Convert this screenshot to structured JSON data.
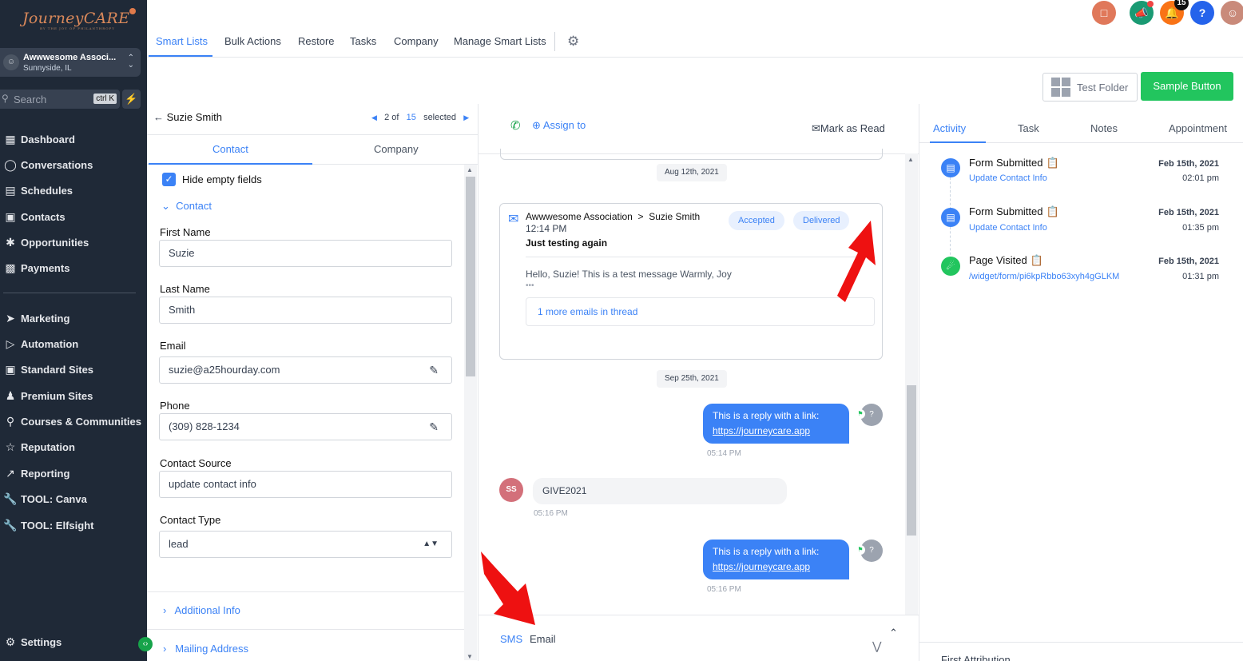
{
  "sidebar": {
    "logo": "JourneyCARE",
    "logo_tagline": "BY THE JOY OF PHILANTHROPY",
    "account_name": "Awwwesome Associ...",
    "account_location": "Sunnyside, IL",
    "search_placeholder": "Search",
    "search_shortcut": "ctrl K",
    "items": [
      {
        "label": "Dashboard",
        "icon": "dashboard-icon"
      },
      {
        "label": "Conversations",
        "icon": "chat-icon"
      },
      {
        "label": "Schedules",
        "icon": "calendar-icon"
      },
      {
        "label": "Contacts",
        "icon": "contacts-icon"
      },
      {
        "label": "Opportunities",
        "icon": "opportunities-icon"
      },
      {
        "label": "Payments",
        "icon": "payments-icon"
      },
      {
        "label": "Marketing",
        "icon": "send-icon"
      },
      {
        "label": "Automation",
        "icon": "automation-icon"
      },
      {
        "label": "Standard Sites",
        "icon": "sites-icon"
      },
      {
        "label": "Premium Sites",
        "icon": "premium-icon"
      },
      {
        "label": "Courses & Communities",
        "icon": "award-icon"
      },
      {
        "label": "Reputation",
        "icon": "star-icon"
      },
      {
        "label": "Reporting",
        "icon": "trend-icon"
      },
      {
        "label": "TOOL: Canva",
        "icon": "wrench-icon"
      },
      {
        "label": "TOOL: Elfsight",
        "icon": "wrench-icon"
      }
    ],
    "settings": "Settings"
  },
  "topnav": {
    "tabs": [
      "Smart Lists",
      "Bulk Actions",
      "Restore",
      "Tasks",
      "Company",
      "Manage Smart Lists"
    ],
    "active_tab": "Smart Lists",
    "notification_count": "15"
  },
  "toolbar": {
    "folder_label": "Test Folder",
    "sample_label": "Sample Button"
  },
  "contact_panel": {
    "back_label": "Suzie Smith",
    "position": "2",
    "of_label": "of",
    "total": "15",
    "selected_label": "selected",
    "tabs": [
      "Contact",
      "Company"
    ],
    "hide_empty_label": "Hide empty fields",
    "section_label": "Contact",
    "fields": [
      {
        "label": "First Name",
        "value": "Suzie"
      },
      {
        "label": "Last Name",
        "value": "Smith"
      },
      {
        "label": "Email",
        "value": "suzie@a25hourday.com"
      },
      {
        "label": "Phone",
        "value": "(309) 828-1234"
      },
      {
        "label": "Contact Source",
        "value": "update contact info"
      },
      {
        "label": "Contact Type",
        "value": "lead"
      }
    ],
    "accordions": [
      "Additional Info",
      "Mailing Address"
    ]
  },
  "conversation": {
    "assign_label": "Assign to",
    "mark_read_label": "Mark as Read",
    "date1": "Aug 12th, 2021",
    "email": {
      "from": "Awwwesome Association",
      "separator": ">",
      "to": "Suzie Smith",
      "time": "12:14 PM",
      "subject": "Just testing again",
      "status1": "Accepted",
      "status2": "Delivered",
      "body": "Hello, Suzie! This is a test message Warmly, Joy",
      "dots": "•••",
      "thread_link": "1 more emails in thread"
    },
    "date2": "Sep 25th, 2021",
    "messages": [
      {
        "text": "This is a reply with a link:",
        "link": "https://journeycare.app",
        "time": "05:14 PM"
      },
      {
        "in_avatar": "SS",
        "text": "GIVE2021",
        "time": "05:16 PM"
      },
      {
        "text": "This is a reply with a link:",
        "link": "https://journeycare.app",
        "time": "05:16 PM"
      }
    ],
    "channels": [
      "SMS",
      "Email"
    ]
  },
  "activity": {
    "tabs": [
      "Activity",
      "Task",
      "Notes",
      "Appointment"
    ],
    "items": [
      {
        "title": "Form Submitted",
        "sub": "Update Contact Info",
        "date": "Feb 15th, 2021",
        "time": "02:01 pm",
        "color": "#3b82f6"
      },
      {
        "title": "Form Submitted",
        "sub": "Update Contact Info",
        "date": "Feb 15th, 2021",
        "time": "01:35 pm",
        "color": "#3b82f6"
      },
      {
        "title": "Page Visited",
        "sub": "/widget/form/pi6kpRbbo63xyh4gGLKM",
        "date": "Feb 15th, 2021",
        "time": "01:31 pm",
        "color": "#22c55e"
      }
    ],
    "first_attribution": "First Attribution"
  }
}
